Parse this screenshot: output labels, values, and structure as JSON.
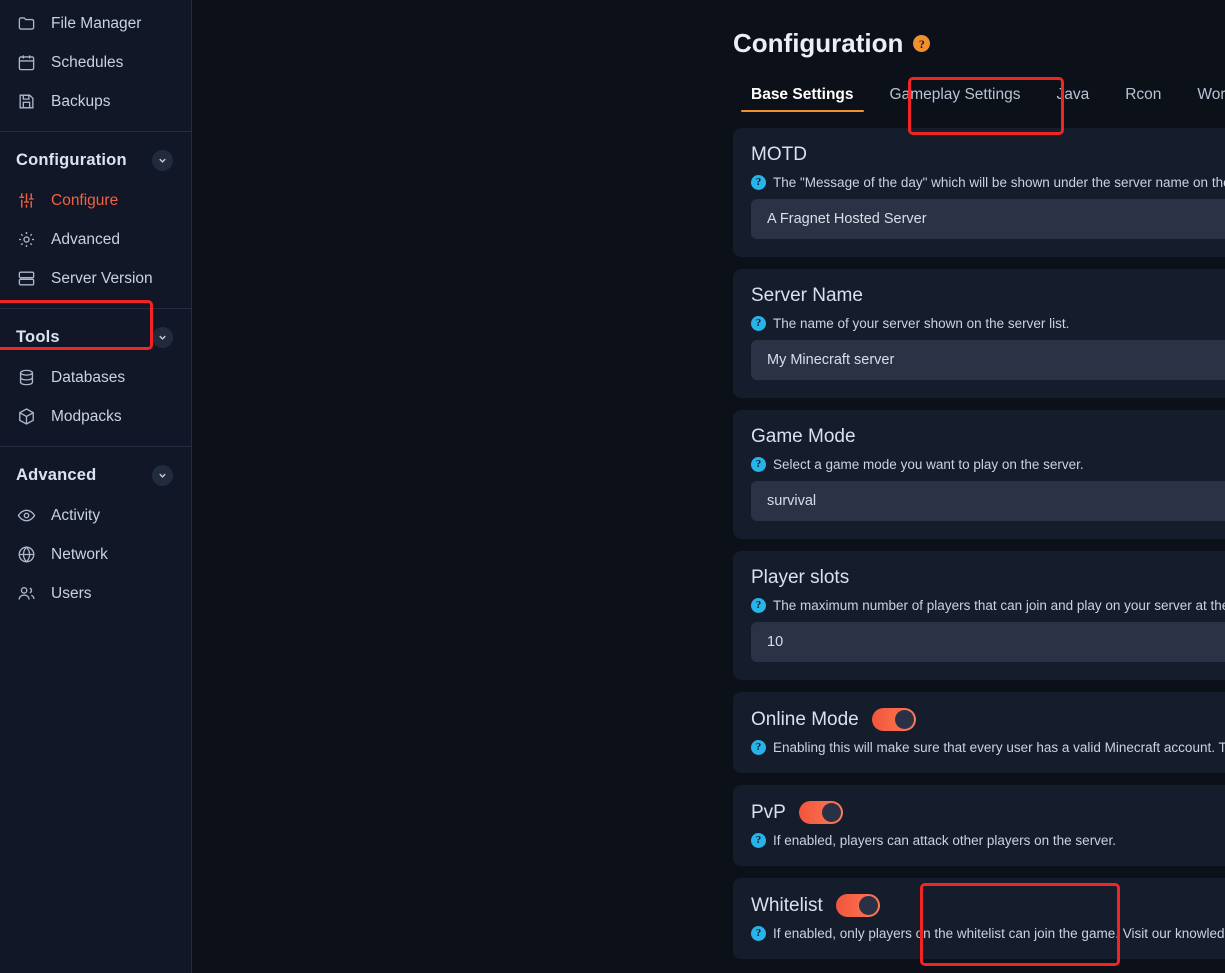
{
  "sidebar": {
    "top_items": [
      {
        "label": "File Manager",
        "icon": "folder-icon"
      },
      {
        "label": "Schedules",
        "icon": "calendar-icon"
      },
      {
        "label": "Backups",
        "icon": "save-icon"
      }
    ],
    "groups": [
      {
        "title": "Configuration",
        "items": [
          {
            "label": "Configure",
            "icon": "sliders-icon",
            "active": true
          },
          {
            "label": "Advanced",
            "icon": "gear-icon",
            "active": false
          },
          {
            "label": "Server Version",
            "icon": "server-icon",
            "active": false
          }
        ]
      },
      {
        "title": "Tools",
        "items": [
          {
            "label": "Databases",
            "icon": "database-icon",
            "active": false
          },
          {
            "label": "Modpacks",
            "icon": "package-icon",
            "active": false
          }
        ]
      },
      {
        "title": "Advanced",
        "items": [
          {
            "label": "Activity",
            "icon": "eye-icon",
            "active": false
          },
          {
            "label": "Network",
            "icon": "globe-icon",
            "active": false
          },
          {
            "label": "Users",
            "icon": "users-icon",
            "active": false
          }
        ]
      }
    ]
  },
  "header": {
    "title": "Configuration",
    "help_glyph": "?"
  },
  "tabs": [
    {
      "label": "Base Settings",
      "active": true
    },
    {
      "label": "Gameplay Settings",
      "active": false
    },
    {
      "label": "Java",
      "active": false
    },
    {
      "label": "Rcon",
      "active": false
    },
    {
      "label": "World",
      "active": false
    }
  ],
  "settings": {
    "motd": {
      "title": "MOTD",
      "description": "The \"Message of the day\" which will be shown under the server name on the server list.",
      "value": "A Fragnet Hosted Server"
    },
    "server_name": {
      "title": "Server Name",
      "description": "The name of your server shown on the server list.",
      "value": "My Minecraft server"
    },
    "game_mode": {
      "title": "Game Mode",
      "description": "Select a game mode you want to play on the server.",
      "value": "survival"
    },
    "player_slots": {
      "title": "Player slots",
      "description": "The maximum number of players that can join and play on your server at the same time.",
      "value": "10"
    },
    "online_mode": {
      "title": "Online Mode",
      "description": "Enabling this will make sure that every user has a valid Minecraft account. This prevents cracked clients.",
      "enabled": true
    },
    "pvp": {
      "title": "PvP",
      "description": "If enabled, players can attack other players on the server.",
      "enabled": true
    },
    "whitelist": {
      "title": "Whitelist",
      "description": "If enabled, only players on the whitelist can join the game. Visit our knowledgebase for more info.",
      "enabled": true
    }
  },
  "colors": {
    "accent_orange": "#f0912e",
    "accent_red": "#f4603f",
    "toggle_on": "#f2553c",
    "help_blue": "#27b4e8",
    "highlight_box": "#f22424",
    "page_bg": "#0b1019",
    "card_bg": "#151c2b",
    "field_bg": "#2b3245",
    "sidebar_bg": "#111726"
  }
}
